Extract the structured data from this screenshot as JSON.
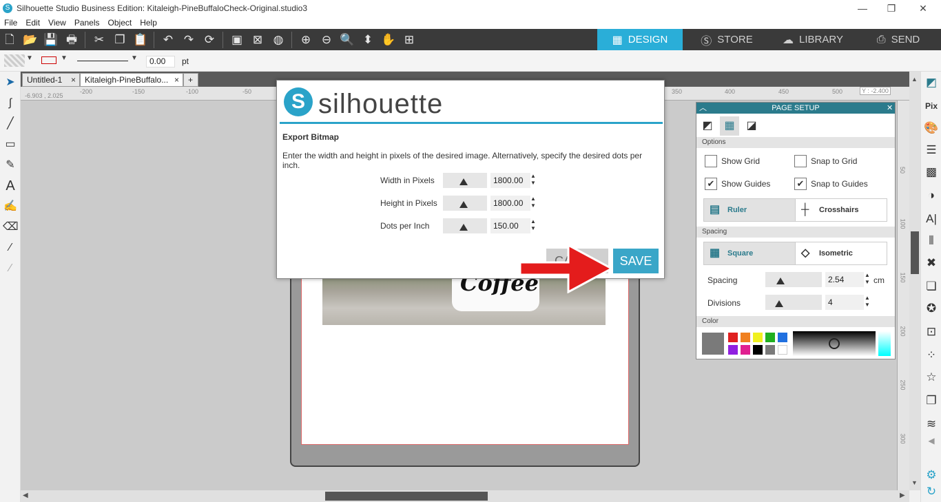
{
  "window": {
    "title": "Silhouette Studio Business Edition: Kitaleigh-PineBuffaloCheck-Original.studio3",
    "controls": [
      "minimize",
      "restore",
      "close"
    ]
  },
  "menu": [
    "File",
    "Edit",
    "View",
    "Panels",
    "Object",
    "Help"
  ],
  "nav_tabs": [
    {
      "label": "DESIGN",
      "icon": "grid-icon",
      "active": true
    },
    {
      "label": "STORE",
      "icon": "store-icon",
      "active": false
    },
    {
      "label": "LIBRARY",
      "icon": "cloud-icon",
      "active": false
    },
    {
      "label": "SEND",
      "icon": "send-icon",
      "active": false
    }
  ],
  "line_options": {
    "width_value": "0.00",
    "unit": "pt"
  },
  "doc_tabs": [
    {
      "label": "Untitled-1",
      "close": "×"
    },
    {
      "label": "Kitaleigh-PineBuffalo...",
      "close": "×"
    },
    {
      "label": "+"
    }
  ],
  "ruler": {
    "coords_left": "-6.903 , 2.025",
    "coord_right": "Y : -2.400",
    "h_ticks": [
      "-200",
      "-150",
      "-100",
      "-50",
      "350",
      "400",
      "450",
      "500"
    ],
    "v_ticks": [
      "50",
      "100",
      "150",
      "200",
      "250",
      "300"
    ]
  },
  "canvas": {
    "image_text": "Coffee"
  },
  "dialog": {
    "brand": "silhouette",
    "heading": "Export Bitmap",
    "description": "Enter the width and height in pixels of the desired image. Alternatively, specify the desired dots per inch.",
    "fields": [
      {
        "label": "Width in Pixels",
        "value": "1800.00"
      },
      {
        "label": "Height in Pixels",
        "value": "1800.00"
      },
      {
        "label": "Dots per Inch",
        "value": "150.00"
      }
    ],
    "cancel_label": "CANC",
    "save_label": "SAVE"
  },
  "page_setup": {
    "title": "PAGE SETUP",
    "options_label": "Options",
    "show_grid": {
      "label": "Show Grid",
      "checked": false
    },
    "snap_to_grid": {
      "label": "Snap to Grid",
      "checked": false
    },
    "show_guides": {
      "label": "Show Guides",
      "checked": true
    },
    "snap_to_guides": {
      "label": "Snap to Guides",
      "checked": true
    },
    "ruler_label": "Ruler",
    "crosshairs_label": "Crosshairs",
    "spacing_section": "Spacing",
    "square_label": "Square",
    "isometric_label": "Isometric",
    "spacing_label": "Spacing",
    "spacing_value": "2.54",
    "spacing_unit": "cm",
    "divisions_label": "Divisions",
    "divisions_value": "4",
    "color_label": "Color",
    "current_color": "#7a7a7a",
    "swatches": [
      "#e02020",
      "#f08020",
      "#f0f020",
      "#20b020",
      "#2070e0",
      "#9020e0",
      "#e02090",
      "#000000",
      "#7a7a7a",
      "#ffffff"
    ]
  }
}
